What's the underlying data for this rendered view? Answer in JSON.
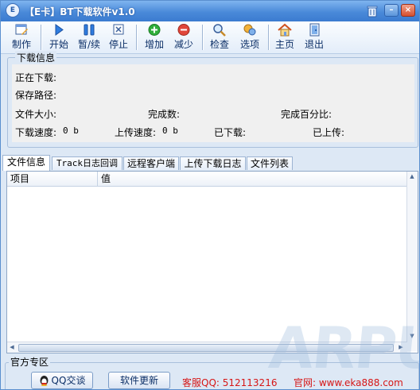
{
  "window": {
    "title": "【E卡】BT下载软件v1.0",
    "app_icon": "E"
  },
  "titlebar_buttons": {
    "minimize": "–",
    "close": "×"
  },
  "toolbar": {
    "make": "制作",
    "start": "开始",
    "pause_resume": "暂/续",
    "stop": "停止",
    "add": "增加",
    "remove": "减少",
    "check": "检查",
    "options": "选项",
    "home": "主页",
    "exit": "退出"
  },
  "download_info": {
    "group_label": "下载信息",
    "downloading_label": "正在下载:",
    "save_path_label": "保存路径:",
    "file_size_label": "文件大小:",
    "completed_count_label": "完成数:",
    "completed_percent_label": "完成百分比:",
    "download_speed_label": "下载速度:",
    "download_speed_value": "0 b",
    "upload_speed_label": "上传速度:",
    "upload_speed_value": "0 b",
    "downloaded_label": "已下载:",
    "uploaded_label": "已上传:"
  },
  "tabs": [
    "文件信息",
    "Track日志回调",
    "远程客户端",
    "上传下载日志",
    "文件列表"
  ],
  "list": {
    "columns": [
      "项目",
      "值"
    ]
  },
  "footer": {
    "group_label": "官方专区",
    "qq_button": "QQ交谈",
    "update_button": "软件更新",
    "service_qq": "客服QQ: 512113216",
    "website": "官网: www.eka888.com"
  },
  "watermark": "ARPUN",
  "colors": {
    "accent": "#3b7bd0",
    "contact_text": "#d61616"
  }
}
